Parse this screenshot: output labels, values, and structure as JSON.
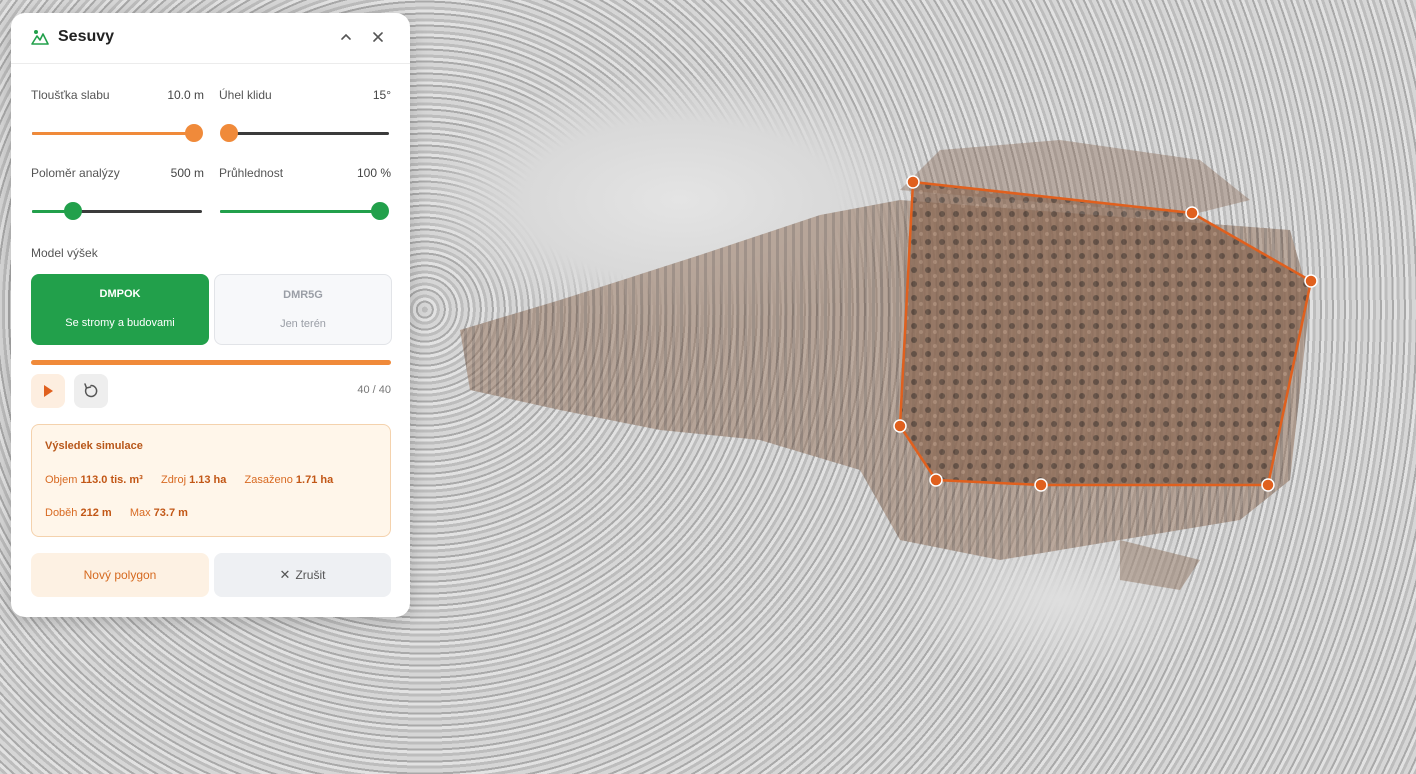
{
  "panel": {
    "title": "Sesuvy",
    "icons": {
      "logo": "landslide-icon",
      "collapse": "chevron-up-icon",
      "close": "close-icon"
    },
    "sliders": [
      {
        "label": "Tloušťka slabu",
        "value": "10.0 m",
        "fraction": 1.0,
        "color": "#f08a3a"
      },
      {
        "label": "Úhel klidu",
        "value": "15°",
        "fraction": 0.0,
        "color": "#f08a3a"
      },
      {
        "label": "Poloměr analýzy",
        "value": "500 m",
        "fraction": 0.24,
        "color": "#22a04b"
      },
      {
        "label": "Průhlednost",
        "value": "100 %",
        "fraction": 1.0,
        "color": "#22a04b"
      }
    ],
    "model_section_label": "Model výšek",
    "models": [
      {
        "name": "DMPOK",
        "desc": "Se stromy a budovami",
        "selected": true
      },
      {
        "name": "DMR5G",
        "desc": "Jen terén",
        "selected": false
      }
    ],
    "progress": {
      "fraction": 1.0,
      "text": "40 / 40"
    },
    "controls": {
      "play": "play-icon",
      "reset": "reset-icon"
    },
    "result": {
      "title": "Výsledek simulace",
      "objem_label": "Objem",
      "objem_value": "113.0 tis. m³",
      "zdroj_label": "Zdroj",
      "zdroj_value": "1.13 ha",
      "zasazeno_label": "Zasaženo",
      "zasazeno_value": "1.71 ha",
      "dobeh_label": "Doběh",
      "dobeh_value": "212 m",
      "max_label": "Max",
      "max_value": "73.7 m"
    },
    "buttons": {
      "new_polygon": "Nový polygon",
      "cancel": "Zrušit"
    }
  },
  "colors": {
    "accent_orange": "#f08a3a",
    "accent_green": "#22a04b",
    "polygon": "#e0601e"
  }
}
